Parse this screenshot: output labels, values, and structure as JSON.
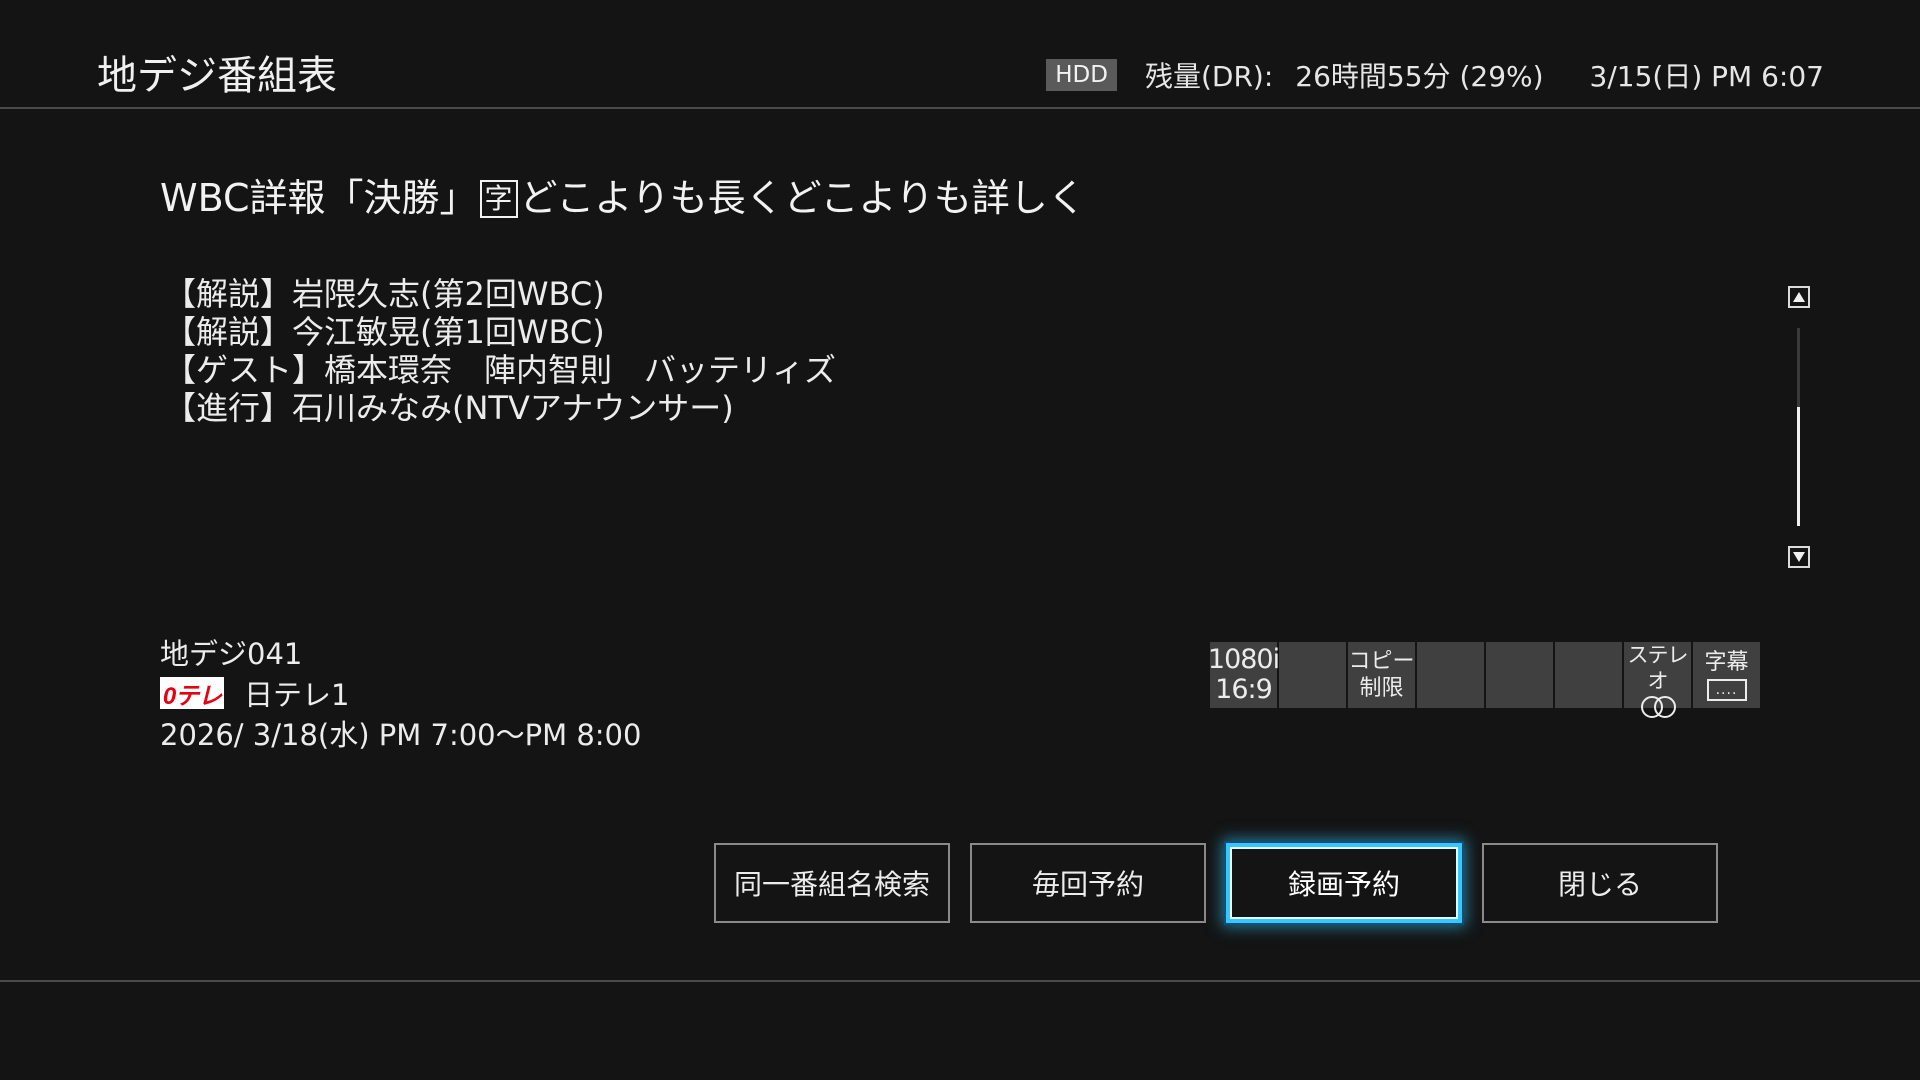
{
  "header": {
    "title": "地デジ番組表",
    "storage_badge": "HDD",
    "remaining_label": "残量(DR):",
    "remaining_value": "26時間55分 (29%)",
    "datetime": "3/15(日) PM 6:07"
  },
  "program": {
    "title_before_mark": "WBC詳報「決勝」",
    "subtitle_mark": "字",
    "title_after_mark": "どこよりも長くどこよりも詳しく",
    "description_lines": [
      "【解説】岩隈久志(第2回WBC)",
      "【解説】今江敏晃(第1回WBC)",
      "【ゲスト】橋本環奈　陣内智則　バッテリィズ",
      "【進行】石川みなみ(NTVアナウンサー)"
    ],
    "scroll_position_fraction": 0.4
  },
  "channel": {
    "code": "地デジ041",
    "logo_text": "0テレ",
    "logo_colors": {
      "background": "#ffffff",
      "text": "#e60012"
    },
    "name": "日テレ1",
    "airtime": "2026/ 3/18(水) PM 7:00〜PM 8:00"
  },
  "attributes": {
    "video_format": [
      "1080i",
      "16:9"
    ],
    "copy_restriction": [
      "コピー",
      "制限"
    ],
    "audio": "ステレオ",
    "audio_icon": "stereo-icon",
    "caption": "字幕",
    "caption_icon_text": "....",
    "caption_icon": "caption-icon"
  },
  "buttons": {
    "same_title_search": "同一番組名検索",
    "every_time_reserve": "毎回予約",
    "record_reserve": "録画予約",
    "close": "閉じる",
    "focused": "record_reserve",
    "focus_color": "#35c8ff"
  }
}
